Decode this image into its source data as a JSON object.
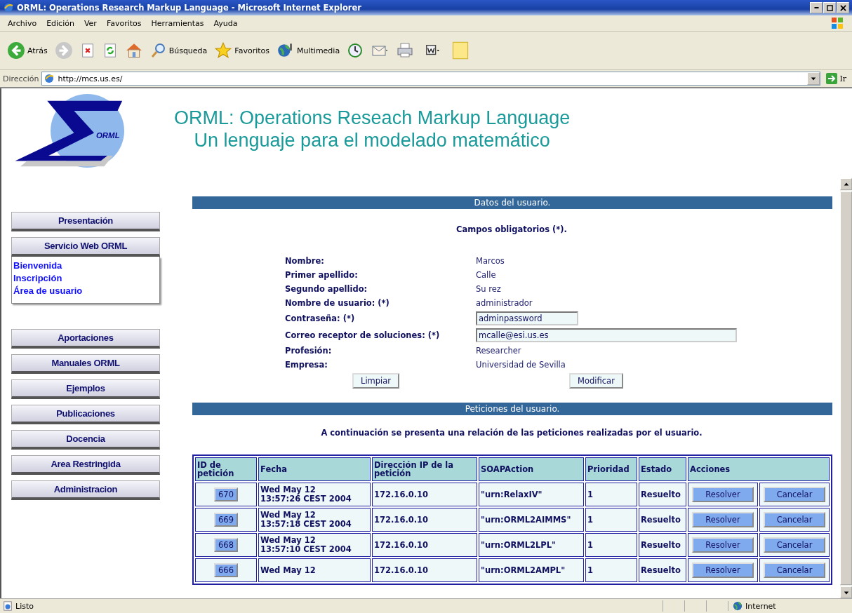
{
  "window": {
    "title": "ORML: Operations Research Markup Language - Microsoft Internet Explorer"
  },
  "menu": [
    "Archivo",
    "Edición",
    "Ver",
    "Favoritos",
    "Herramientas",
    "Ayuda"
  ],
  "toolbar": [
    {
      "kind": "back",
      "label": "Atrás"
    },
    {
      "kind": "forward"
    },
    {
      "kind": "stop"
    },
    {
      "kind": "refresh"
    },
    {
      "kind": "home"
    },
    {
      "kind": "search",
      "label": "Búsqueda"
    },
    {
      "kind": "favorites",
      "label": "Favoritos"
    },
    {
      "kind": "media",
      "label": "Multimedia"
    },
    {
      "kind": "history"
    },
    {
      "kind": "mail"
    },
    {
      "kind": "print"
    },
    {
      "kind": "edit"
    },
    {
      "kind": "note"
    }
  ],
  "address": {
    "label": "Dirección",
    "url": "http://mcs.us.es/",
    "go": "Ir"
  },
  "header": {
    "title": "ORML: Operations Reseach Markup Language",
    "subtitle": "Un lenguaje para el modelado matemático",
    "logo_text": "ORML"
  },
  "sidebar": [
    {
      "kind": "button",
      "label": "Presentación"
    },
    {
      "kind": "group",
      "label": "Servicio Web ORML",
      "links": [
        "Bienvenida",
        "Inscripción",
        "Área de usuario"
      ]
    },
    {
      "kind": "button",
      "label": "Aportaciones"
    },
    {
      "kind": "button",
      "label": "Manuales ORML"
    },
    {
      "kind": "button",
      "label": "Ejemplos"
    },
    {
      "kind": "button",
      "label": "Publicaciones"
    },
    {
      "kind": "button",
      "label": "Docencia"
    },
    {
      "kind": "button",
      "label": "Area Restringida"
    },
    {
      "kind": "button",
      "label": "Administracion"
    }
  ],
  "user_section": {
    "title": "Datos del usuario.",
    "note": "Campos obligatorios (*).",
    "fields": [
      {
        "kind": "text",
        "label": "Nombre:",
        "value": "Marcos"
      },
      {
        "kind": "text",
        "label": "Primer apellido:",
        "value": "Calle"
      },
      {
        "kind": "text",
        "label": "Segundo apellido:",
        "value": "Su rez"
      },
      {
        "kind": "text",
        "label": "Nombre de usuario: (*)",
        "value": "administrador"
      },
      {
        "kind": "short_input",
        "label": "Contraseña: (*)",
        "value": "adminpassword"
      },
      {
        "kind": "long_input",
        "label": "Correo receptor de soluciones: (*)",
        "value": "mcalle@esi.us.es"
      },
      {
        "kind": "text",
        "label": "Profesión:",
        "value": "Researcher"
      },
      {
        "kind": "text",
        "label": "Empresa:",
        "value": "Universidad de Sevilla"
      }
    ],
    "buttons": [
      "Limpiar",
      "Modificar"
    ]
  },
  "requests_section": {
    "title": "Peticiones del usuario.",
    "intro": "A continuación se presenta una relación de las peticiones realizadas por el usuario.",
    "table": {
      "columns": [
        "ID de petición",
        "Fecha",
        "Dirección IP de la petición",
        "SOAPAction",
        "Prioridad",
        "Estado",
        "Acciones"
      ],
      "rows": [
        {
          "id": "670",
          "date": [
            "Wed May 12",
            "13:57:26 CEST 2004"
          ],
          "ip": "172.16.0.10",
          "action": "\"urn:RelaxIV\"",
          "priority": "1",
          "status": "Resuelto",
          "buttons": [
            "Resolver",
            "Cancelar"
          ]
        },
        {
          "id": "669",
          "date": [
            "Wed May 12",
            "13:57:18 CEST 2004"
          ],
          "ip": "172.16.0.10",
          "action": "\"urn:ORML2AIMMS\"",
          "priority": "1",
          "status": "Resuelto",
          "buttons": [
            "Resolver",
            "Cancelar"
          ]
        },
        {
          "id": "668",
          "date": [
            "Wed May 12",
            "13:57:10 CEST 2004"
          ],
          "ip": "172.16.0.10",
          "action": "\"urn:ORML2LPL\"",
          "priority": "1",
          "status": "Resuelto",
          "buttons": [
            "Resolver",
            "Cancelar"
          ]
        },
        {
          "id": "666",
          "date": [
            "Wed May 12"
          ],
          "ip": "172.16.0.10",
          "action": "\"urn:ORML2AMPL\"",
          "priority": "1",
          "status": "Resuelto",
          "buttons": [
            "Resolver",
            "Cancelar"
          ]
        }
      ]
    }
  },
  "status_bar": {
    "text": "Listo",
    "zone": "Internet"
  }
}
